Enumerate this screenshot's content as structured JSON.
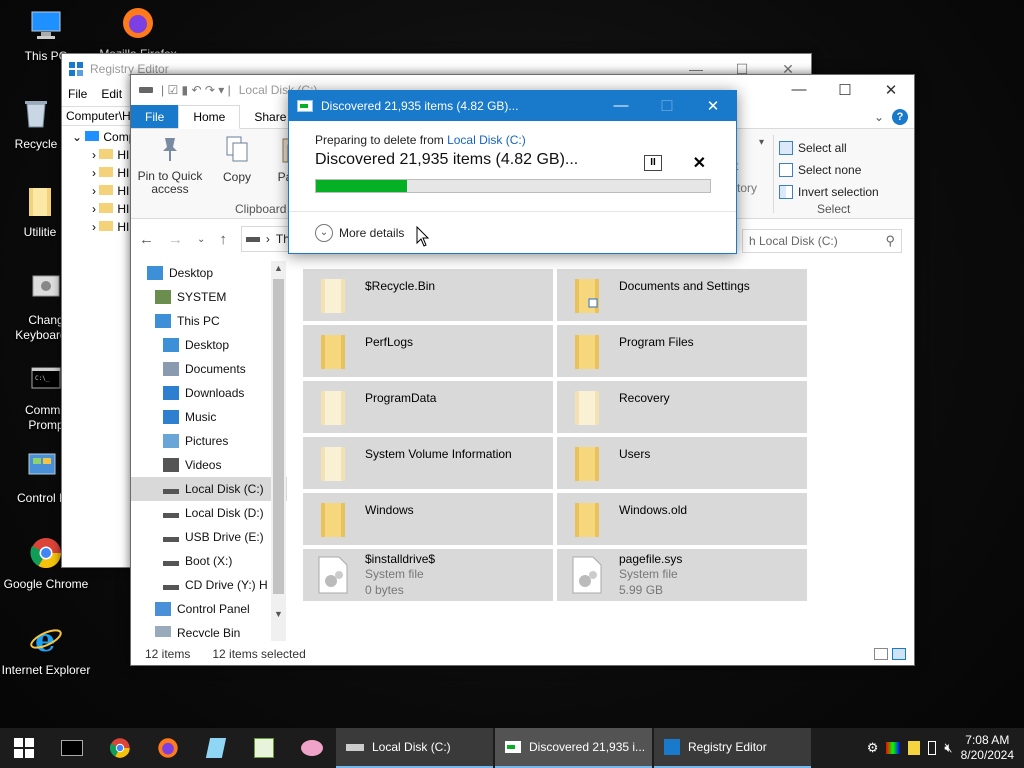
{
  "desktop": {
    "icons": [
      {
        "label": "This PC"
      },
      {
        "label": "Mozilla Firefox"
      },
      {
        "label": "Recycle"
      },
      {
        "label": "Utilitie"
      },
      {
        "label": "Chang Keyboard L"
      },
      {
        "label": "Comma Promp"
      },
      {
        "label": "Control P"
      },
      {
        "label": "Google Chrome"
      },
      {
        "label": "Internet Explorer"
      }
    ]
  },
  "registry": {
    "title": "Registry Editor",
    "menu": [
      "File",
      "Edit"
    ],
    "address": "Computer\\H",
    "tree_root": "Comp",
    "tree_items": [
      "HI",
      "HI",
      "HI",
      "HI",
      "HI"
    ]
  },
  "explorer": {
    "title_path": "Local Disk (C:)",
    "tabs": {
      "file": "File",
      "home": "Home",
      "share": "Share"
    },
    "ribbon": {
      "pin": "Pin to Quick access",
      "copy": "Copy",
      "paste": "Paste",
      "clipboard_group": "Clipboard",
      "move": "t",
      "history": "story",
      "select_all": "Select all",
      "select_none": "Select none",
      "invert": "Invert selection",
      "select_group": "Select"
    },
    "address_text": "Th",
    "search_placeholder": "h Local Disk (C:)",
    "nav": [
      {
        "label": "Desktop",
        "indent": 1
      },
      {
        "label": "SYSTEM",
        "indent": 2
      },
      {
        "label": "This PC",
        "indent": 2
      },
      {
        "label": "Desktop",
        "indent": 3
      },
      {
        "label": "Documents",
        "indent": 3
      },
      {
        "label": "Downloads",
        "indent": 3
      },
      {
        "label": "Music",
        "indent": 3
      },
      {
        "label": "Pictures",
        "indent": 3
      },
      {
        "label": "Videos",
        "indent": 3
      },
      {
        "label": "Local Disk (C:)",
        "indent": 3,
        "selected": true
      },
      {
        "label": "Local Disk (D:)",
        "indent": 3
      },
      {
        "label": "USB Drive (E:)",
        "indent": 3
      },
      {
        "label": "Boot (X:)",
        "indent": 3
      },
      {
        "label": "CD Drive (Y:) H",
        "indent": 3
      },
      {
        "label": "Control Panel",
        "indent": 2
      },
      {
        "label": "Recycle Bin",
        "indent": 2
      }
    ],
    "items": [
      {
        "name": "$Recycle.Bin",
        "kind": "folder-light"
      },
      {
        "name": "Documents and Settings",
        "kind": "folder-link"
      },
      {
        "name": "PerfLogs",
        "kind": "folder"
      },
      {
        "name": "Program Files",
        "kind": "folder"
      },
      {
        "name": "ProgramData",
        "kind": "folder-light"
      },
      {
        "name": "Recovery",
        "kind": "folder-light"
      },
      {
        "name": "System Volume Information",
        "kind": "folder-light"
      },
      {
        "name": "Users",
        "kind": "folder"
      },
      {
        "name": "Windows",
        "kind": "folder"
      },
      {
        "name": "Windows.old",
        "kind": "folder"
      },
      {
        "name": "$installdrive$",
        "kind": "file",
        "type": "System file",
        "size": "0 bytes"
      },
      {
        "name": "pagefile.sys",
        "kind": "file",
        "type": "System file",
        "size": "5.99 GB"
      }
    ],
    "status": {
      "count": "12 items",
      "selected": "12 items selected"
    }
  },
  "dialog": {
    "title": "Discovered 21,935 items (4.82 GB)...",
    "prep_prefix": "Preparing to delete from ",
    "prep_link": "Local Disk (C:)",
    "status": "Discovered 21,935 items (4.82 GB)...",
    "progress": 0.23,
    "more_details": "More details"
  },
  "taskbar": {
    "apps": [
      {
        "label": "Local Disk (C:)"
      },
      {
        "label": "Discovered 21,935 i..."
      },
      {
        "label": "Registry Editor"
      }
    ],
    "time": "7:08 AM",
    "date": "8/20/2024"
  },
  "colors": {
    "accent": "#1979ca",
    "progress": "#06b025",
    "tile": "#d9d9d9"
  }
}
